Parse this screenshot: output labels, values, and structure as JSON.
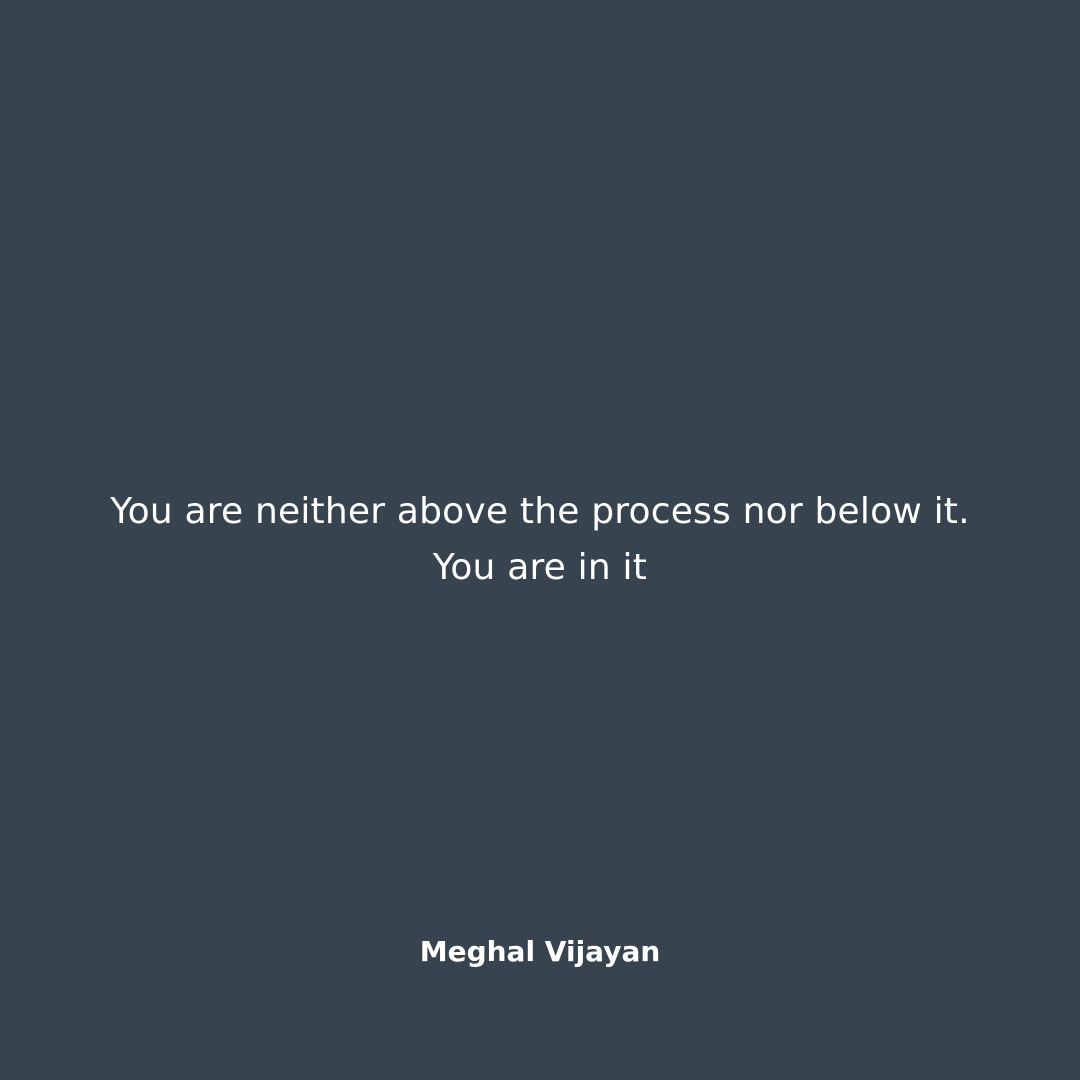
{
  "post": {
    "quote": "You are neither above the process nor below it. You are in it",
    "author": "Meghal Vijayan"
  },
  "colors": {
    "background": "#37444f",
    "text": "#ffffff"
  }
}
